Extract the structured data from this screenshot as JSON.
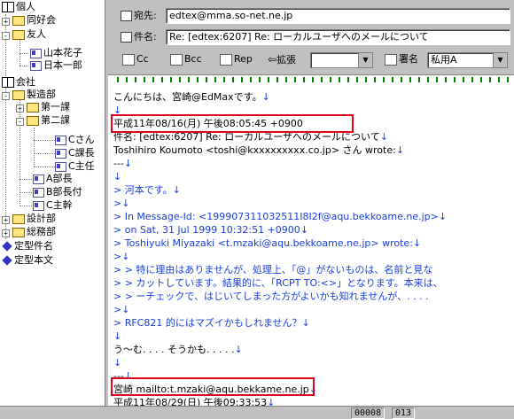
{
  "tree": {
    "items": [
      {
        "label": "個人"
      },
      {
        "label": "同好会"
      },
      {
        "label": "友人"
      },
      {
        "label": "山本花子"
      },
      {
        "label": "日本一郎"
      },
      {
        "label": "会社"
      },
      {
        "label": "製造部"
      },
      {
        "label": "第一課"
      },
      {
        "label": "第二課"
      },
      {
        "label": "Cさん"
      },
      {
        "label": "C課長"
      },
      {
        "label": "C主任"
      },
      {
        "label": "A部長"
      },
      {
        "label": "B部長付"
      },
      {
        "label": "C主幹"
      },
      {
        "label": "設計部"
      },
      {
        "label": "総務部"
      },
      {
        "label": "定型件名"
      },
      {
        "label": "定型本文"
      }
    ]
  },
  "header": {
    "to_label": "宛先:",
    "to_value": "edtex@mma.so-net.ne.jp",
    "subject_label": "件名:",
    "subject_value": "Re: [edtex:6207] Re: ローカルユーザへのメールについて",
    "cc": "Cc",
    "bcc": "Bcc",
    "rep": "Rep",
    "extend": "拡張",
    "signature": "署名",
    "signature_value": "私用A"
  },
  "message": {
    "lines": [
      "こんにちは、宮崎@EdMaxです。",
      "",
      "平成11年08/16(月) 午後08:05:45 +0900",
      "件名: [edtex:6207] Re: ローカルユーザへのメールについて",
      "Toshihiro Koumoto <toshi@kxxxxxxxxx.co.jp> さん wrote:",
      "---",
      "",
      "> 河本です。",
      ">",
      "> In Message-Id: <199907311032511I8I2f@aqu.bekkoame.ne.jp>",
      "> on Sat, 31 Jul 1999 10:32:51 +0900",
      "> Toshiyuki Miyazaki <t.mzaki@aqu.bekkoame.ne.jp> wrote:",
      ">",
      "> > 特に理由はありませんが、処理上、「@」がないものは、名前と見な",
      "> > カットしています。結果的に、「RCPT TO:<>」となります。本来は、",
      "> > ーチェックで、はじいてしまった方がよいかも知れませんが、. . . .",
      ">",
      "> RFC821 的にはマズイかもしれません？",
      "",
      "う～む. . . . そうかも. . . . .",
      "",
      "---",
      "宮崎 mailto:t.mzaki@aqu.bekkame.ne.jp",
      "平成11年08/29(日) 午後09:33:53"
    ],
    "return_mark": "↓"
  },
  "status": {
    "field1": "00008",
    "field2": "013"
  }
}
